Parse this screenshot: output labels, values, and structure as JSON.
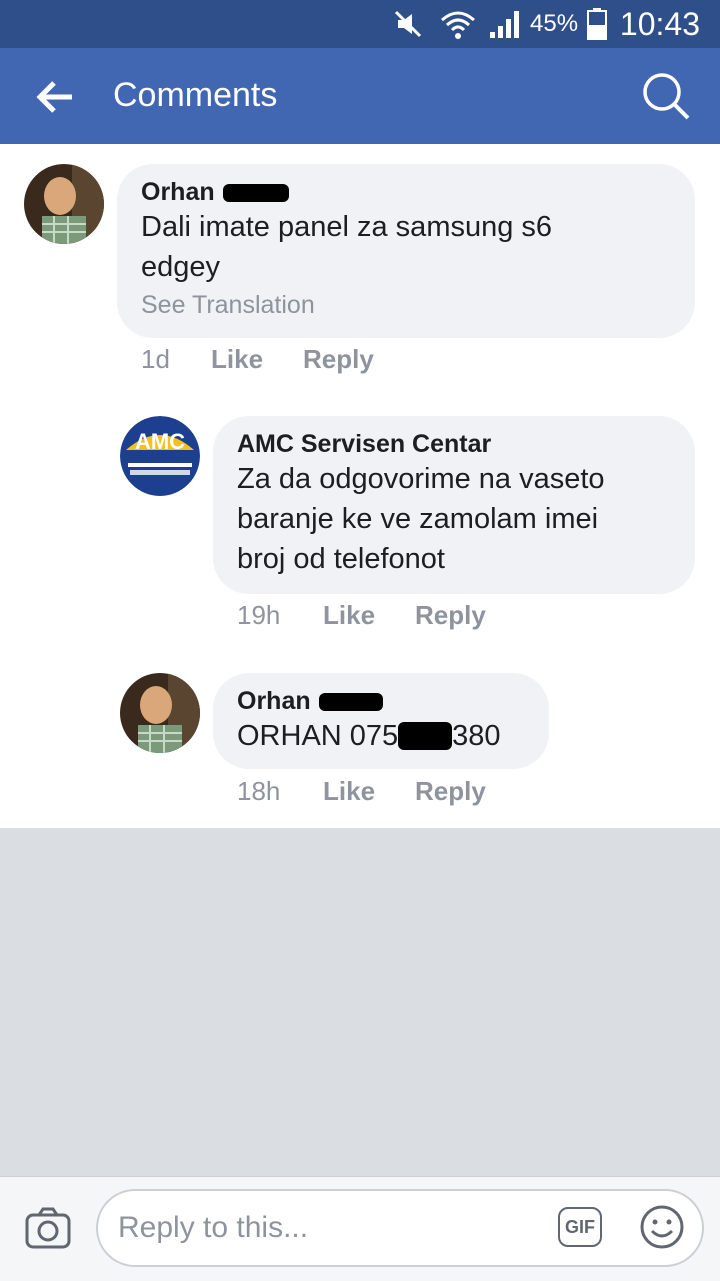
{
  "status_bar": {
    "battery": "45%",
    "time": "10:43"
  },
  "header": {
    "title": "Comments"
  },
  "comments": [
    {
      "author": "Orhan",
      "text_lines": [
        "Dali imate panel za samsung s6",
        "edgey"
      ],
      "see_translation": "See Translation",
      "time": "1d",
      "like": "Like",
      "reply": "Reply"
    },
    {
      "author": "AMC Servisen Centar",
      "text_lines": [
        "Za da odgovorime na vaseto",
        "baranje ke ve zamolam imei",
        "broj od telefonot"
      ],
      "time": "19h",
      "like": "Like",
      "reply": "Reply",
      "logo_text": "AMC"
    },
    {
      "author": "Orhan",
      "text_prefix": "ORHAN 075",
      "text_suffix": "380",
      "time": "18h",
      "like": "Like",
      "reply": "Reply"
    }
  ],
  "composer": {
    "placeholder": "Reply to this...",
    "gif_label": "GIF"
  },
  "colors": {
    "brand": "#4267b2",
    "status_bar": "#2f4f8a",
    "bubble": "#f0f2f5"
  }
}
